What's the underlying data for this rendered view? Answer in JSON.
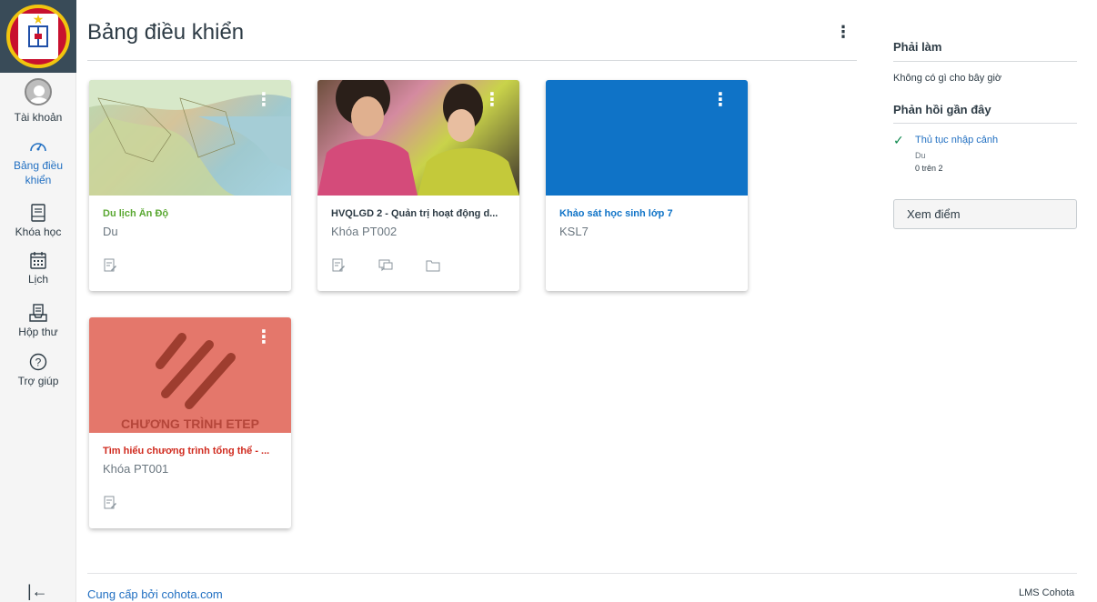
{
  "nav": {
    "account": "Tài khoản",
    "dashboard": "Bảng điều khiển",
    "courses": "Khóa học",
    "calendar": "Lịch",
    "inbox": "Hộp thư",
    "help": "Trợ giúp"
  },
  "page": {
    "title": "Bảng điều khiển"
  },
  "cards": [
    {
      "title": "Du lịch Ấn Độ",
      "code": "Du",
      "color": "#5aa832"
    },
    {
      "title": "HVQLGD 2 - Quản trị hoạt động d...",
      "code": "Khóa PT002",
      "color": "#2d3b45"
    },
    {
      "title": "Khảo sát học sinh lớp 7",
      "code": "KSL7",
      "color": "#0f73c7"
    },
    {
      "title": "Tìm hiểu chương trình tổng thể - ...",
      "code": "Khóa PT001",
      "color": "#d02a1e",
      "hero_text": "CHƯƠNG TRÌNH ETEP"
    }
  ],
  "sidebar": {
    "todo_heading": "Phải làm",
    "todo_empty": "Không có gì cho bây giờ",
    "feedback_heading": "Phản hồi gần đây",
    "feedback_item": {
      "title": "Thủ tục nhập cảnh",
      "course": "Du",
      "score": "0 trên 2"
    },
    "grades_button": "Xem điểm"
  },
  "footer": {
    "powered_by": "Cung cấp bởi cohota.com",
    "brand": "LMS Cohota"
  }
}
